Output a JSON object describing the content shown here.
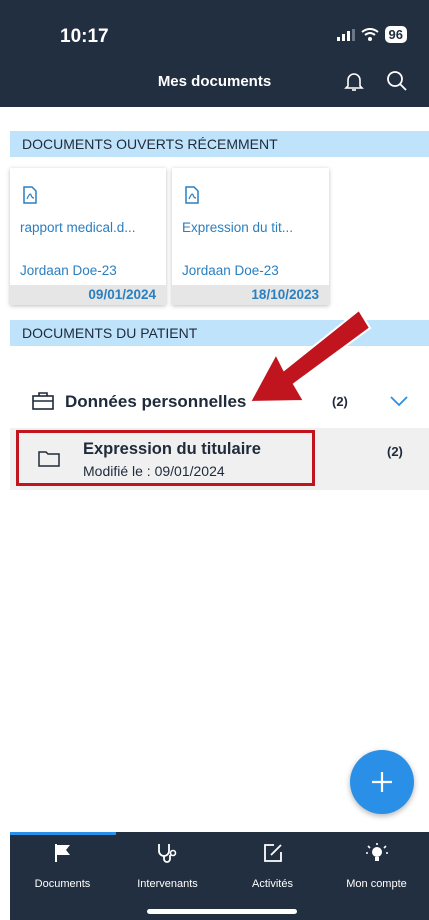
{
  "status": {
    "time": "10:17",
    "battery": "96"
  },
  "header": {
    "title": "Mes documents"
  },
  "recent": {
    "section_title": "DOCUMENTS OUVERTS RÉCEMMENT",
    "cards": [
      {
        "name": "rapport medical.d...",
        "owner": "Jordaan Doe-23",
        "date": "09/01/2024"
      },
      {
        "name": "Expression du tit...",
        "owner": "Jordaan Doe-23",
        "date": "18/10/2023"
      }
    ]
  },
  "patient": {
    "section_title": "DOCUMENTS DU PATIENT",
    "folder": {
      "label": "Données personnelles",
      "count": "(2)"
    },
    "documents": [
      {
        "title": "Expression du titulaire",
        "date": "Modifié le : 09/01/2024",
        "count": "(2)"
      }
    ]
  },
  "nav": {
    "items": [
      {
        "label": "Documents",
        "icon": "flag-icon"
      },
      {
        "label": "Intervenants",
        "icon": "stethoscope-icon"
      },
      {
        "label": "Activités",
        "icon": "edit-icon"
      },
      {
        "label": "Mon compte",
        "icon": "lightbulb-icon"
      }
    ]
  },
  "colors": {
    "header": "#222f40",
    "accent": "#2a8fe6",
    "section": "#bfe3fb",
    "highlight": "#c0151e",
    "arrow": "#c0151e"
  }
}
